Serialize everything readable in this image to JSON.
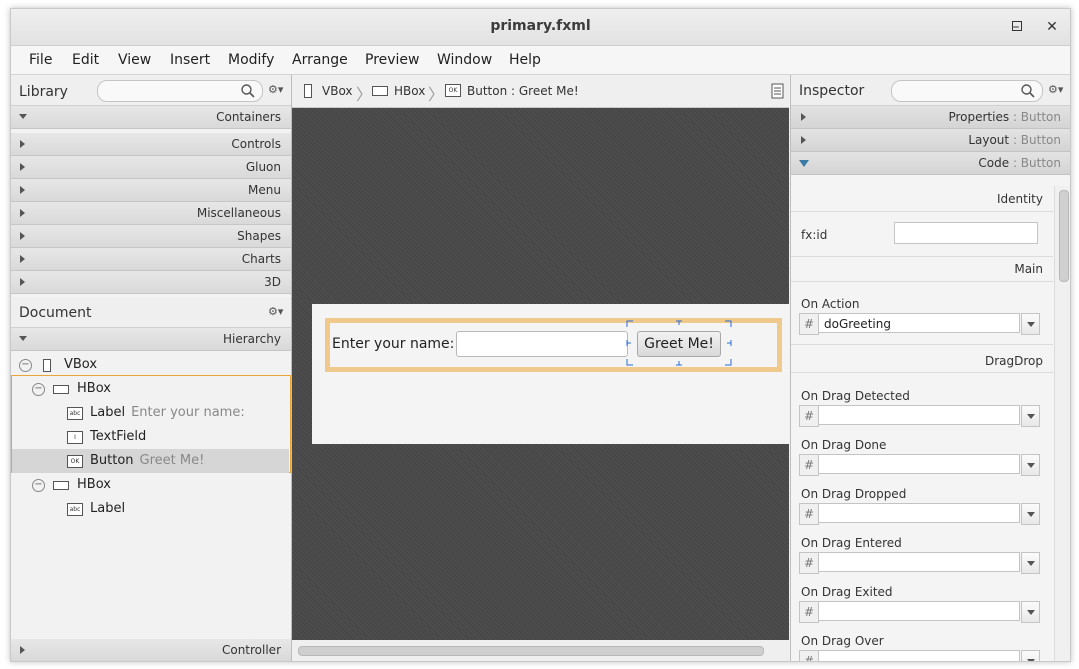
{
  "window": {
    "title": "primary.fxml"
  },
  "window_controls": {
    "minimize": "–",
    "maximize": "□",
    "close": "✕"
  },
  "menu": [
    "File",
    "Edit",
    "View",
    "Insert",
    "Modify",
    "Arrange",
    "Preview",
    "Window",
    "Help"
  ],
  "library": {
    "title": "Library",
    "sections": [
      "Containers",
      "Controls",
      "Gluon",
      "Menu",
      "Miscellaneous",
      "Shapes",
      "Charts",
      "3D"
    ]
  },
  "document": {
    "title": "Document",
    "section": "Hierarchy",
    "tree": [
      {
        "label": "VBox",
        "sub": ""
      },
      {
        "label": "HBox",
        "sub": ""
      },
      {
        "label": "Label",
        "sub": "Enter your name:"
      },
      {
        "label": "TextField",
        "sub": ""
      },
      {
        "label": "Button",
        "sub": "Greet Me!"
      },
      {
        "label": "HBox",
        "sub": ""
      },
      {
        "label": "Label",
        "sub": ""
      }
    ],
    "controller": "Controller"
  },
  "breadcrumb": [
    {
      "label": "VBox",
      "icon": "vbox-icon"
    },
    {
      "label": "HBox",
      "icon": "hbox-icon"
    },
    {
      "label": "Button : Greet Me!",
      "icon": "button-icon"
    }
  ],
  "preview": {
    "label": "Enter your name:",
    "button": "Greet Me!"
  },
  "inspector": {
    "title": "Inspector",
    "sections": [
      {
        "name": "Properties",
        "target": "Button"
      },
      {
        "name": "Layout",
        "target": "Button"
      },
      {
        "name": "Code",
        "target": "Button"
      }
    ],
    "identity_heading": "Identity",
    "fxid_label": "fx:id",
    "fxid_value": "",
    "main_heading": "Main",
    "on_action_label": "On Action",
    "on_action_value": "doGreeting",
    "hash": "#",
    "dragdrop_heading": "DragDrop",
    "dragdrop": [
      {
        "label": "On Drag Detected",
        "value": ""
      },
      {
        "label": "On Drag Done",
        "value": ""
      },
      {
        "label": "On Drag Dropped",
        "value": ""
      },
      {
        "label": "On Drag Entered",
        "value": ""
      },
      {
        "label": "On Drag Exited",
        "value": ""
      },
      {
        "label": "On Drag Over",
        "value": ""
      }
    ]
  },
  "colors": {
    "selection": "#e8a63a",
    "hbox_highlight": "#f0c98c",
    "canvas": "#474747"
  }
}
